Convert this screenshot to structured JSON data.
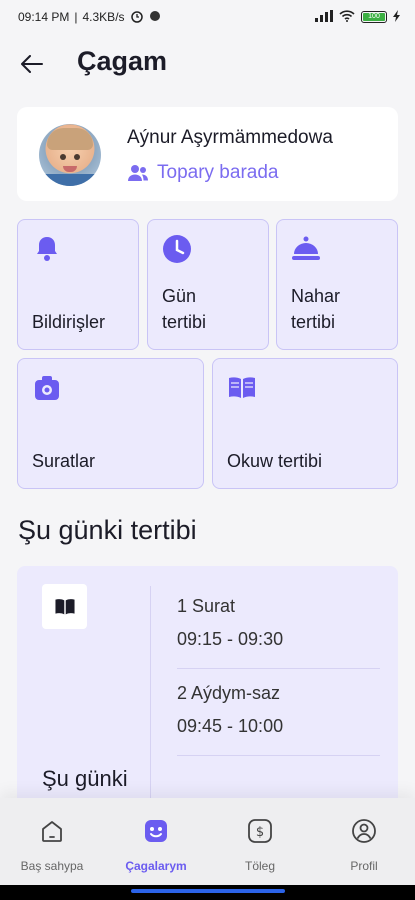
{
  "status_bar": {
    "time": "09:14 PM",
    "network_speed": "4.3KB/s",
    "battery_level": "100"
  },
  "header": {
    "title": "Çagam"
  },
  "profile": {
    "name": "Aýnur Aşyrmämmedowa",
    "group_link": "Topary barada"
  },
  "tiles": [
    {
      "label": "Bildirişler",
      "icon": "bell-icon"
    },
    {
      "label": "Gün tertibi",
      "icon": "clock-icon"
    },
    {
      "label": "Nahar tertibi",
      "icon": "food-cloche-icon"
    },
    {
      "label": "Suratlar",
      "icon": "camera-icon"
    },
    {
      "label": "Okuw tertibi",
      "icon": "book-icon"
    }
  ],
  "schedule": {
    "section_title": "Şu günki tertibi",
    "today_label": "Şu günki",
    "items": [
      {
        "name": "1 Surat",
        "time": "09:15 - 09:30"
      },
      {
        "name": "2 Aýdym-saz",
        "time": "09:45 - 10:00"
      }
    ]
  },
  "bottom_nav": [
    {
      "label": "Baş sahypa",
      "icon": "home-icon",
      "active": false
    },
    {
      "label": "Çagalarym",
      "icon": "child-face-icon",
      "active": true
    },
    {
      "label": "Töleg",
      "icon": "payment-icon",
      "active": false
    },
    {
      "label": "Profil",
      "icon": "user-profile-icon",
      "active": false
    }
  ],
  "colors": {
    "accent": "#6b5cf0",
    "tile_background": "#eceafd",
    "tile_border": "#c9c4f6"
  }
}
